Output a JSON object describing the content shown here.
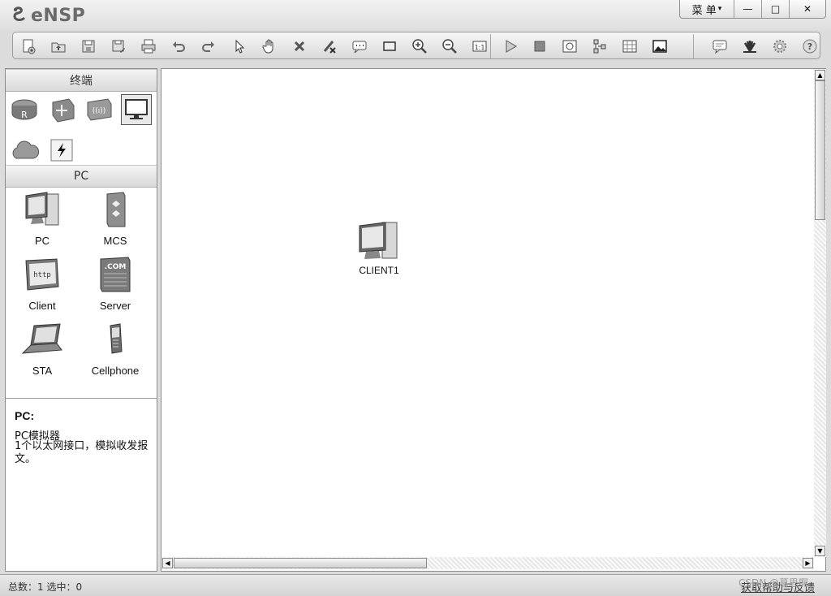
{
  "app": {
    "name": "eNSP"
  },
  "window_controls": {
    "menu_label": "菜 单",
    "minimize": "—",
    "maximize": "□",
    "close": "✕"
  },
  "toolbar": {
    "icons": [
      "new-topology-icon",
      "open-icon",
      "save-icon",
      "save-as-icon",
      "print-icon",
      "undo-icon",
      "redo-icon",
      "select-icon",
      "pan-hand-icon",
      "delete-icon",
      "delete-link-icon",
      "text-note-icon",
      "rectangle-icon",
      "zoom-in-icon",
      "zoom-out-icon",
      "fit-view-icon",
      "start-device-icon",
      "stop-device-icon",
      "capture-icon",
      "topology-icon",
      "grid-icon",
      "image-icon",
      "feedback-icon",
      "huawei-icon",
      "settings-icon",
      "help-icon"
    ]
  },
  "left_panel": {
    "category_header": "终端",
    "categories": [
      "router-icon",
      "switch-icon",
      "wireless-icon",
      "terminal-icon",
      "cloud-icon",
      "link-icon"
    ],
    "device_header": "PC",
    "devices": [
      {
        "label": "PC",
        "icon": "pc-icon"
      },
      {
        "label": "MCS",
        "icon": "mcs-server-icon"
      },
      {
        "label": "Client",
        "icon": "http-client-icon"
      },
      {
        "label": "Server",
        "icon": "com-server-icon"
      },
      {
        "label": "STA",
        "icon": "laptop-icon"
      },
      {
        "label": "Cellphone",
        "icon": "cellphone-icon"
      }
    ]
  },
  "description": {
    "title": "PC:",
    "line1": "PC模拟器",
    "line2": "1个以太网接口，模拟收发报文。"
  },
  "canvas": {
    "devices": [
      {
        "label": "CLIENT1",
        "icon": "client-pc-icon"
      }
    ]
  },
  "status_bar": {
    "text": "总数：1  选中：0",
    "help": "获取帮助与反馈"
  },
  "watermark": "CSDN @葛思啊"
}
